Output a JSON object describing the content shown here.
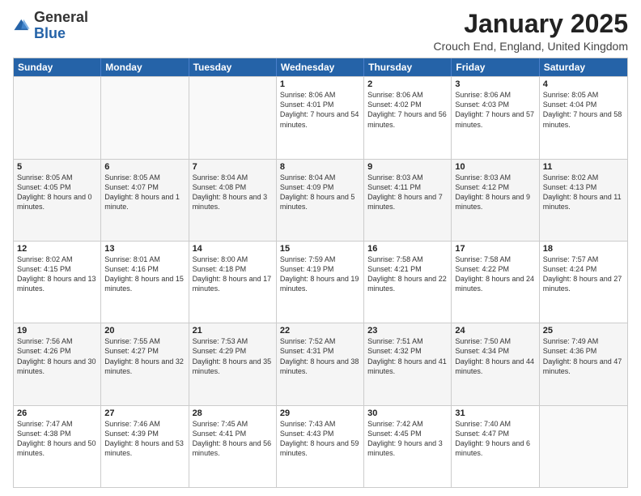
{
  "logo": {
    "general": "General",
    "blue": "Blue"
  },
  "header": {
    "month": "January 2025",
    "location": "Crouch End, England, United Kingdom"
  },
  "weekdays": [
    "Sunday",
    "Monday",
    "Tuesday",
    "Wednesday",
    "Thursday",
    "Friday",
    "Saturday"
  ],
  "rows": [
    [
      {
        "day": "",
        "text": ""
      },
      {
        "day": "",
        "text": ""
      },
      {
        "day": "",
        "text": ""
      },
      {
        "day": "1",
        "text": "Sunrise: 8:06 AM\nSunset: 4:01 PM\nDaylight: 7 hours and 54 minutes."
      },
      {
        "day": "2",
        "text": "Sunrise: 8:06 AM\nSunset: 4:02 PM\nDaylight: 7 hours and 56 minutes."
      },
      {
        "day": "3",
        "text": "Sunrise: 8:06 AM\nSunset: 4:03 PM\nDaylight: 7 hours and 57 minutes."
      },
      {
        "day": "4",
        "text": "Sunrise: 8:05 AM\nSunset: 4:04 PM\nDaylight: 7 hours and 58 minutes."
      }
    ],
    [
      {
        "day": "5",
        "text": "Sunrise: 8:05 AM\nSunset: 4:05 PM\nDaylight: 8 hours and 0 minutes."
      },
      {
        "day": "6",
        "text": "Sunrise: 8:05 AM\nSunset: 4:07 PM\nDaylight: 8 hours and 1 minute."
      },
      {
        "day": "7",
        "text": "Sunrise: 8:04 AM\nSunset: 4:08 PM\nDaylight: 8 hours and 3 minutes."
      },
      {
        "day": "8",
        "text": "Sunrise: 8:04 AM\nSunset: 4:09 PM\nDaylight: 8 hours and 5 minutes."
      },
      {
        "day": "9",
        "text": "Sunrise: 8:03 AM\nSunset: 4:11 PM\nDaylight: 8 hours and 7 minutes."
      },
      {
        "day": "10",
        "text": "Sunrise: 8:03 AM\nSunset: 4:12 PM\nDaylight: 8 hours and 9 minutes."
      },
      {
        "day": "11",
        "text": "Sunrise: 8:02 AM\nSunset: 4:13 PM\nDaylight: 8 hours and 11 minutes."
      }
    ],
    [
      {
        "day": "12",
        "text": "Sunrise: 8:02 AM\nSunset: 4:15 PM\nDaylight: 8 hours and 13 minutes."
      },
      {
        "day": "13",
        "text": "Sunrise: 8:01 AM\nSunset: 4:16 PM\nDaylight: 8 hours and 15 minutes."
      },
      {
        "day": "14",
        "text": "Sunrise: 8:00 AM\nSunset: 4:18 PM\nDaylight: 8 hours and 17 minutes."
      },
      {
        "day": "15",
        "text": "Sunrise: 7:59 AM\nSunset: 4:19 PM\nDaylight: 8 hours and 19 minutes."
      },
      {
        "day": "16",
        "text": "Sunrise: 7:58 AM\nSunset: 4:21 PM\nDaylight: 8 hours and 22 minutes."
      },
      {
        "day": "17",
        "text": "Sunrise: 7:58 AM\nSunset: 4:22 PM\nDaylight: 8 hours and 24 minutes."
      },
      {
        "day": "18",
        "text": "Sunrise: 7:57 AM\nSunset: 4:24 PM\nDaylight: 8 hours and 27 minutes."
      }
    ],
    [
      {
        "day": "19",
        "text": "Sunrise: 7:56 AM\nSunset: 4:26 PM\nDaylight: 8 hours and 30 minutes."
      },
      {
        "day": "20",
        "text": "Sunrise: 7:55 AM\nSunset: 4:27 PM\nDaylight: 8 hours and 32 minutes."
      },
      {
        "day": "21",
        "text": "Sunrise: 7:53 AM\nSunset: 4:29 PM\nDaylight: 8 hours and 35 minutes."
      },
      {
        "day": "22",
        "text": "Sunrise: 7:52 AM\nSunset: 4:31 PM\nDaylight: 8 hours and 38 minutes."
      },
      {
        "day": "23",
        "text": "Sunrise: 7:51 AM\nSunset: 4:32 PM\nDaylight: 8 hours and 41 minutes."
      },
      {
        "day": "24",
        "text": "Sunrise: 7:50 AM\nSunset: 4:34 PM\nDaylight: 8 hours and 44 minutes."
      },
      {
        "day": "25",
        "text": "Sunrise: 7:49 AM\nSunset: 4:36 PM\nDaylight: 8 hours and 47 minutes."
      }
    ],
    [
      {
        "day": "26",
        "text": "Sunrise: 7:47 AM\nSunset: 4:38 PM\nDaylight: 8 hours and 50 minutes."
      },
      {
        "day": "27",
        "text": "Sunrise: 7:46 AM\nSunset: 4:39 PM\nDaylight: 8 hours and 53 minutes."
      },
      {
        "day": "28",
        "text": "Sunrise: 7:45 AM\nSunset: 4:41 PM\nDaylight: 8 hours and 56 minutes."
      },
      {
        "day": "29",
        "text": "Sunrise: 7:43 AM\nSunset: 4:43 PM\nDaylight: 8 hours and 59 minutes."
      },
      {
        "day": "30",
        "text": "Sunrise: 7:42 AM\nSunset: 4:45 PM\nDaylight: 9 hours and 3 minutes."
      },
      {
        "day": "31",
        "text": "Sunrise: 7:40 AM\nSunset: 4:47 PM\nDaylight: 9 hours and 6 minutes."
      },
      {
        "day": "",
        "text": ""
      }
    ]
  ]
}
